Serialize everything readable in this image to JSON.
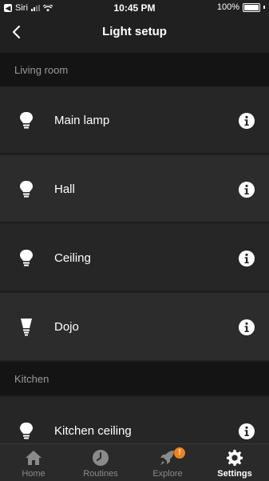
{
  "status_bar": {
    "back_app": "Siri",
    "time": "10:45 PM",
    "battery": "100%"
  },
  "nav": {
    "title": "Light setup",
    "back_icon": "chevron-left-icon"
  },
  "sections": [
    {
      "header": "Living room",
      "lights": [
        {
          "label": "Main lamp",
          "icon": "bulb-icon"
        },
        {
          "label": "Hall",
          "icon": "bulb-icon"
        },
        {
          "label": "Ceiling",
          "icon": "bulb-icon"
        },
        {
          "label": "Dojo",
          "icon": "bulb-icon"
        }
      ]
    },
    {
      "header": "Kitchen",
      "lights": [
        {
          "label": "Kitchen ceiling",
          "icon": "bulb-icon"
        }
      ]
    }
  ],
  "tabs": [
    {
      "label": "Home",
      "icon": "home-icon",
      "active": false
    },
    {
      "label": "Routines",
      "icon": "clock-icon",
      "active": false
    },
    {
      "label": "Explore",
      "icon": "rocket-icon",
      "active": false,
      "badge": "!"
    },
    {
      "label": "Settings",
      "icon": "gear-icon",
      "active": true
    }
  ],
  "colors": {
    "background": "#202020",
    "section_header_bg": "#141414",
    "badge": "#f0821e"
  }
}
